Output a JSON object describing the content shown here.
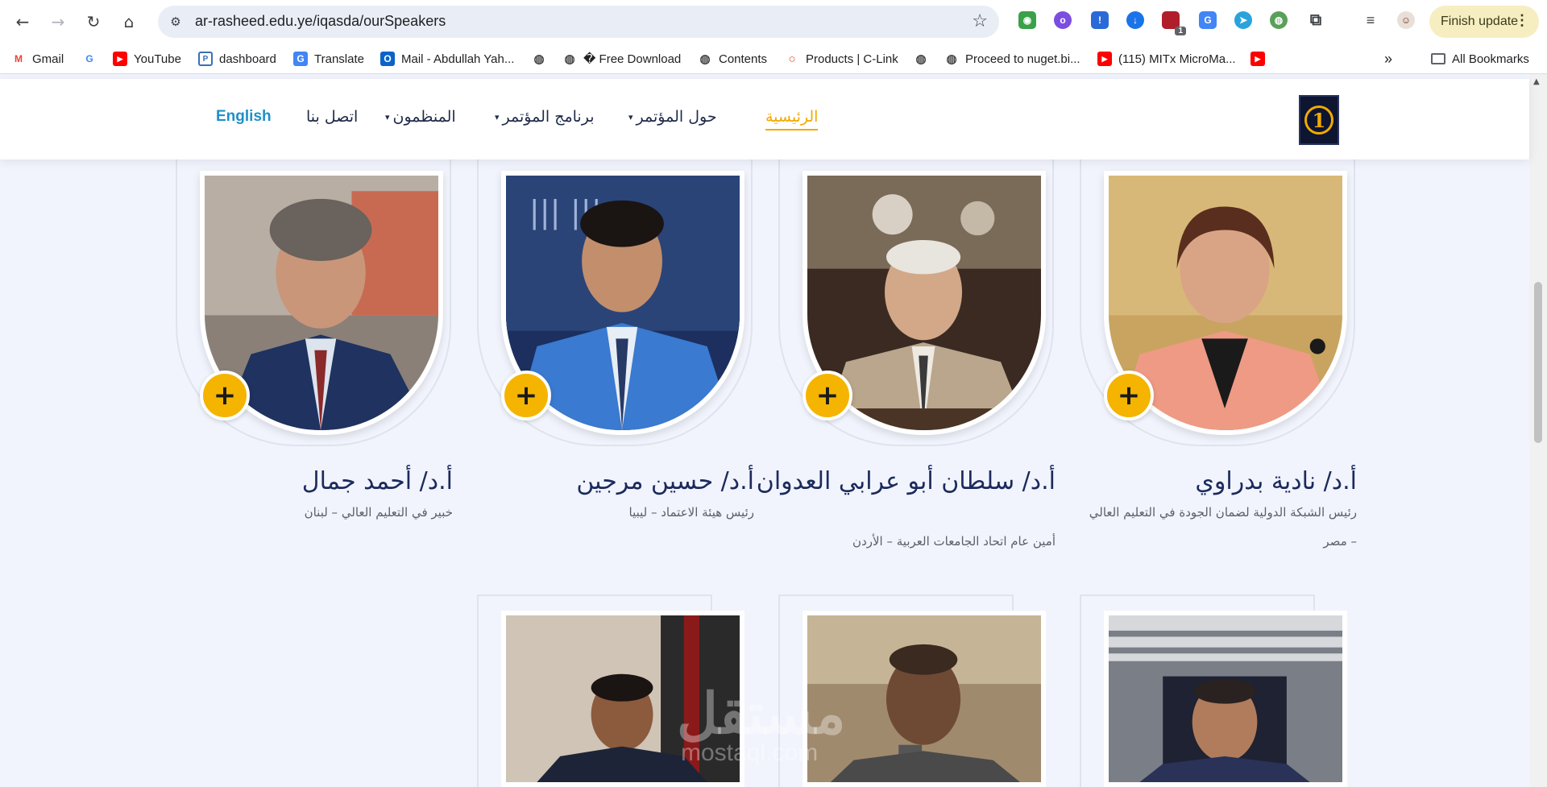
{
  "browser": {
    "url": "ar-rasheed.edu.ye/iqasda/ourSpeakers",
    "finish_update": "Finish update",
    "extension_badge": "1",
    "bookmarks": [
      {
        "label": "Gmail",
        "icon": "gmail-icon",
        "color": "#ea4335"
      },
      {
        "label": "",
        "icon": "google-icon",
        "color": "#4285f4"
      },
      {
        "label": "YouTube",
        "icon": "youtube-icon",
        "color": "#ff0000"
      },
      {
        "label": "dashboard",
        "icon": "dashboard-icon",
        "color": "#3b6fb6"
      },
      {
        "label": "Translate",
        "icon": "translate-icon",
        "color": "#4285f4"
      },
      {
        "label": "Mail - Abdullah Yah...",
        "icon": "outlook-icon",
        "color": "#0a64c8"
      },
      {
        "label": "",
        "icon": "globe-icon",
        "color": "#444444"
      },
      {
        "label": "� Free Download",
        "icon": "globe-icon",
        "color": "#444444"
      },
      {
        "label": "Contents",
        "icon": "globe-icon",
        "color": "#444444"
      },
      {
        "label": "Products | C-Link",
        "icon": "clink-icon",
        "color": "#e34b2a"
      },
      {
        "label": "",
        "icon": "globe-icon",
        "color": "#444444"
      },
      {
        "label": "Proceed to nuget.bi...",
        "icon": "globe-icon",
        "color": "#444444"
      },
      {
        "label": "(115) MITx MicroMa...",
        "icon": "youtube-icon",
        "color": "#ff0000"
      },
      {
        "label": "",
        "icon": "youtube-icon",
        "color": "#ff0000"
      }
    ],
    "more_bookmarks": "»",
    "all_bookmarks": "All Bookmarks"
  },
  "site": {
    "accent_color": "#f2a900",
    "menu": {
      "home": "الرئيسية",
      "about": "حول المؤتمر",
      "program": "برنامج المؤتمر",
      "organizers": "المنظمون",
      "contact": "اتصل بنا",
      "language": "English"
    },
    "logo_number": "1"
  },
  "speakers": [
    {
      "name": "أ.د/ نادية بدراوي",
      "title": "رئيس الشبكة الدولية لضمان الجودة في التعليم العالي – مصر"
    },
    {
      "name": "أ.د/ سلطان أبو عرابي العدوان",
      "title": "أمين عام اتحاد الجامعات العربية – الأردن"
    },
    {
      "name": "أ.د/ حسين مرجين",
      "title": "رئيس هيئة الاعتماد – ليبيا"
    },
    {
      "name": "أ.د/ أحمد جمال",
      "title": "خبير في التعليم العالي – لبنان"
    }
  ],
  "plus_label": "+",
  "watermark": {
    "arabic": "مستقل",
    "latin": "mostaql.com"
  }
}
